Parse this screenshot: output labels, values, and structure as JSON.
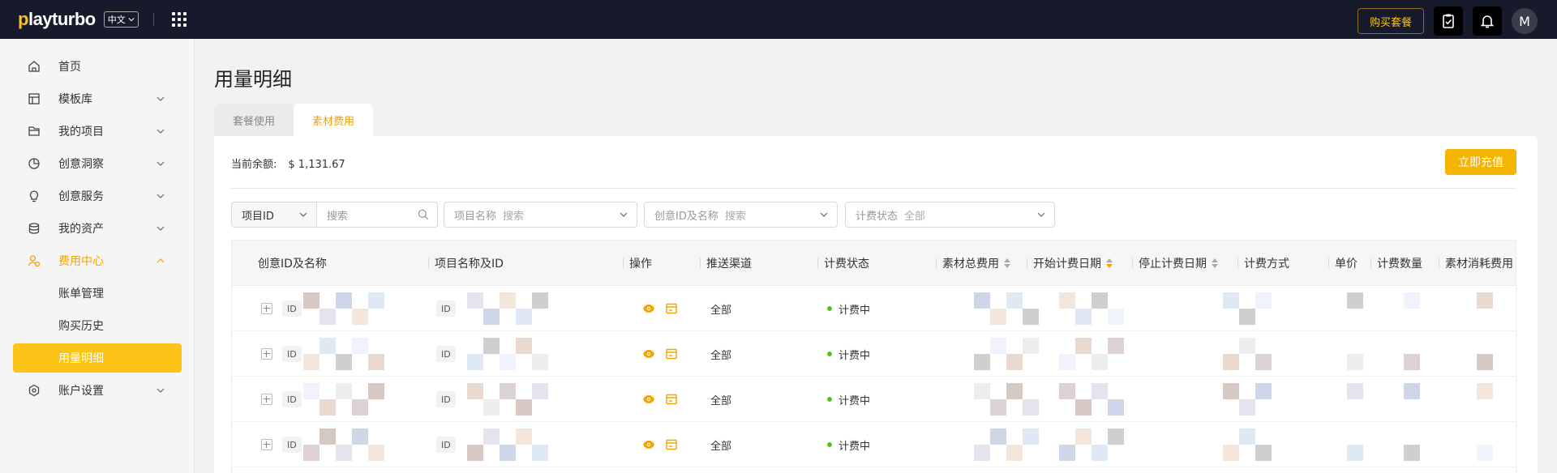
{
  "topbar": {
    "logo_pre": "play",
    "logo_post": "turbo",
    "logo_first": "p",
    "language": "中文",
    "buy_label": "购买套餐",
    "avatar": "M"
  },
  "sidebar": {
    "items": [
      {
        "label": "首页",
        "icon": "home-icon"
      },
      {
        "label": "模板库",
        "icon": "template-icon"
      },
      {
        "label": "我的项目",
        "icon": "folder-icon"
      },
      {
        "label": "创意洞察",
        "icon": "chart-pie-icon"
      },
      {
        "label": "创意服务",
        "icon": "bulb-icon"
      },
      {
        "label": "我的资产",
        "icon": "database-icon"
      },
      {
        "label": "费用中心",
        "icon": "user-billing-icon"
      },
      {
        "label": "账单管理"
      },
      {
        "label": "购买历史"
      },
      {
        "label": "用量明细"
      },
      {
        "label": "账户设置",
        "icon": "settings-icon"
      }
    ],
    "accent_color": "#f5a300",
    "selected_bg": "#fcc419"
  },
  "main": {
    "title": "用量明细",
    "tabs": [
      "套餐使用",
      "素材费用"
    ],
    "balance_label": "当前余额:",
    "balance_value": "$ 1,131.67",
    "recharge_label": "立即充值",
    "filters": {
      "project_id_select": "项目ID",
      "search_placeholder": "搜索",
      "project_name_label": "项目名称",
      "project_name_placeholder": "搜索",
      "creative_label": "创意ID及名称",
      "creative_placeholder": "搜索",
      "billing_status_label": "计费状态",
      "billing_status_value": "全部"
    },
    "table": {
      "headers": [
        "创意ID及名称",
        "项目名称及ID",
        "操作",
        "推送渠道",
        "计费状态",
        "素材总费用",
        "开始计费日期",
        "停止计费日期",
        "计费方式",
        "单价",
        "计费数量",
        "素材消耗费用"
      ],
      "rows": [
        {
          "id_tag": "ID",
          "project_id_tag": "ID",
          "channel": "全部",
          "status": "计费中"
        },
        {
          "id_tag": "ID",
          "project_id_tag": "ID",
          "channel": "全部",
          "status": "计费中"
        },
        {
          "id_tag": "ID",
          "project_id_tag": "ID",
          "channel": "全部",
          "status": "计费中"
        },
        {
          "id_tag": "ID",
          "project_id_tag": "ID",
          "channel": "全部",
          "status": "计费中"
        }
      ]
    }
  }
}
